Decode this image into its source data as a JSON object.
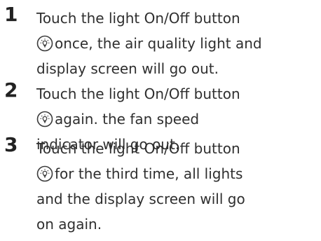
{
  "steps": [
    {
      "number": "1",
      "line1": "Touch the light On/Off button",
      "line2": "once, the air quality light and",
      "line3": "display screen will go out."
    },
    {
      "number": "2",
      "line1": "Touch the light On/Off button",
      "line2": "again. the fan speed",
      "line3": "indicator will go out."
    },
    {
      "number": "3",
      "line1": "Touch the light On/Off button",
      "line2": "for the third time, all lights",
      "line3": "and the display screen will go",
      "line4": "on again."
    }
  ],
  "icons": {
    "light_button": "light-bulb-icon"
  },
  "colors": {
    "text": "#2f2f2f",
    "number": "#222222",
    "icon_stroke": "#3a3a3a"
  }
}
